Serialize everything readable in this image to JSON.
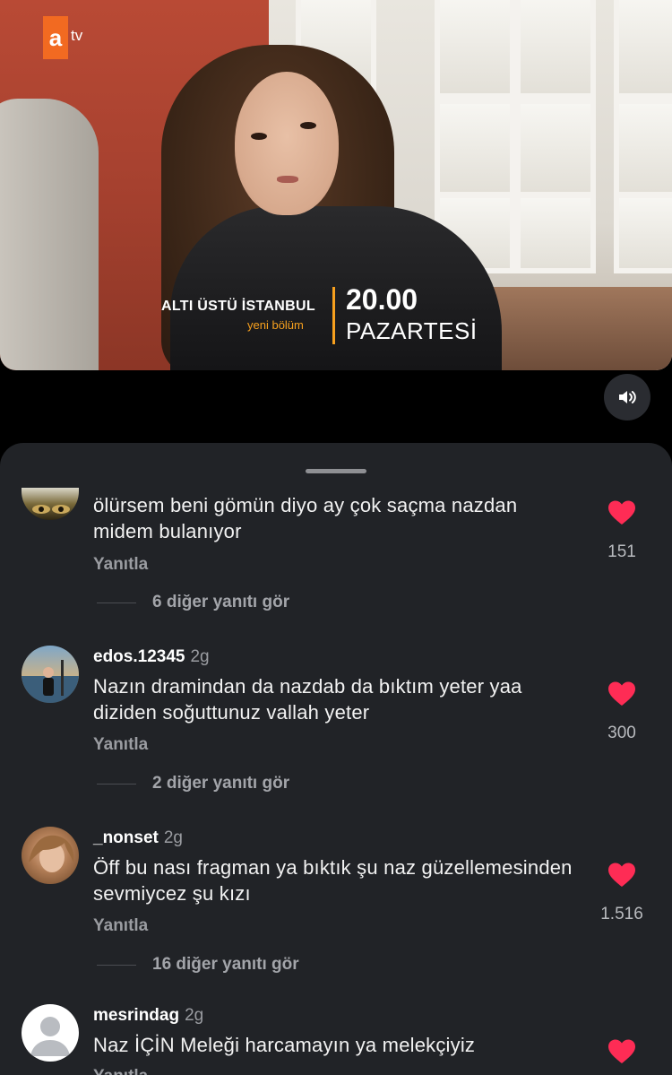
{
  "video": {
    "channel_logo_letter": "a",
    "channel_logo_suffix": "tv",
    "show_title": "ALTI ÜSTÜ İSTANBUL",
    "show_subtitle": "yeni bölüm",
    "air_time": "20.00",
    "air_day": "PAZARTESİ"
  },
  "colors": {
    "sheet_bg": "#212327",
    "heart": "#fe2c55",
    "accent_orange": "#f7a01e",
    "atv_orange": "#f26a21"
  },
  "icons": {
    "sound": "speaker-volume-icon",
    "like": "heart-icon",
    "avatar_placeholder": "person-icon"
  },
  "comments": [
    {
      "username": "",
      "time": "",
      "text": "ölürsem beni gömün diyo ay çok saçma nazdan midem bulanıyor",
      "reply_label": "Yanıtla",
      "likes": "151",
      "more_replies": "6 diğer yanıtı gör"
    },
    {
      "username": "edos.12345",
      "time": "2g",
      "text": "Nazın dramindan da nazdab da bıktım yeter yaa diziden soğuttunuz vallah yeter",
      "reply_label": "Yanıtla",
      "likes": "300",
      "more_replies": "2 diğer yanıtı gör"
    },
    {
      "username": "_nonset",
      "time": "2g",
      "text": "Öff bu nası fragman ya bıktık şu naz güzellemesinden sevmiycez şu kızı",
      "reply_label": "Yanıtla",
      "likes": "1.516",
      "more_replies": "16 diğer yanıtı gör"
    },
    {
      "username": "mesrindag",
      "time": "2g",
      "text": "Naz İÇİN Meleği harcamayın ya melekçiyiz",
      "reply_label": "Yanıtla",
      "likes": "",
      "more_replies": ""
    }
  ]
}
